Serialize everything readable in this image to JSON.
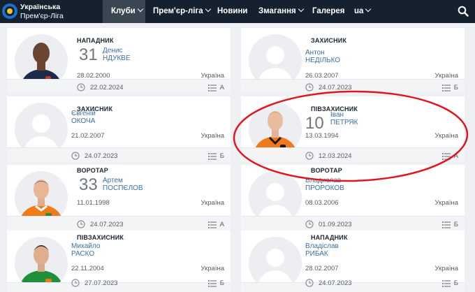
{
  "header": {
    "logo_line1": "Українська",
    "logo_line2": "Прем'єр-Ліга",
    "nav": [
      {
        "label": "Клуби",
        "has_dropdown": true,
        "active": true
      },
      {
        "label": "Прем'єр-ліга",
        "has_dropdown": true,
        "active": false
      },
      {
        "label": "Новини",
        "has_dropdown": false,
        "active": false
      },
      {
        "label": "Змагання",
        "has_dropdown": true,
        "active": false
      },
      {
        "label": "Галерея",
        "has_dropdown": false,
        "active": false
      },
      {
        "label": "ua",
        "has_dropdown": true,
        "active": false
      }
    ],
    "search_icon": "search-icon"
  },
  "players": [
    {
      "position": "НАПАДНИК",
      "number": "31",
      "first_name": "Денис",
      "last_name": "НДУКВЕ",
      "birth_date": "28.02.2000",
      "country": "Україна",
      "joined": "22.02.2024",
      "flag": "А",
      "photo": "player-photo"
    },
    {
      "position": "ЗАХИСНИК",
      "number": "",
      "first_name": "Антон",
      "last_name": "НЕДІЛЬКО",
      "birth_date": "26.03.2007",
      "country": "Україна",
      "joined": "24.07.2023",
      "flag": "Б",
      "photo": "placeholder-avatar"
    },
    {
      "position": "ЗАХИСНИК",
      "number": "",
      "first_name": "Євгеній",
      "last_name": "ОКОЧА",
      "birth_date": "21.02.2007",
      "country": "Україна",
      "joined": "24.07.2023",
      "flag": "Б",
      "photo": "placeholder-avatar"
    },
    {
      "position": "ПІВЗАХИСНИК",
      "number": "10",
      "first_name": "Іван",
      "last_name": "ПЕТРЯК",
      "birth_date": "13.03.1994",
      "country": "Україна",
      "joined": "12.03.2024",
      "flag": "А",
      "photo": "player-photo"
    },
    {
      "position": "ВОРОТАР",
      "number": "33",
      "first_name": "Артем",
      "last_name": "ПОСПЄЛОВ",
      "birth_date": "11.01.1998",
      "country": "Україна",
      "joined": "24.07.2023",
      "flag": "А",
      "photo": "player-photo"
    },
    {
      "position": "ВОРОТАР",
      "number": "",
      "first_name": "Владислав",
      "last_name": "ПРОРОКОВ",
      "birth_date": "08.03.2006",
      "country": "Україна",
      "joined": "01.09.2023",
      "flag": "Б",
      "photo": "placeholder-avatar"
    },
    {
      "position": "ПІВЗАХИСНИК",
      "number": "",
      "first_name": "Михайло",
      "last_name": "РАСКО",
      "birth_date": "22.11.2004",
      "country": "Україна",
      "joined": "27.07.2023",
      "flag": "Б",
      "photo": "player-photo"
    },
    {
      "position": "НАПАДНИК",
      "number": "",
      "first_name": "Владіслав",
      "last_name": "РИБАК",
      "birth_date": "28.02.2007",
      "country": "Україна",
      "joined": "24.07.2023",
      "flag": "Б",
      "photo": "placeholder-avatar"
    }
  ],
  "annotation": {
    "color": "#e0161f",
    "target": "player-card-petriak"
  },
  "colors": {
    "header_bg": "#15212f",
    "link": "#3d6fa5",
    "annotation": "#e0161f",
    "kit_orange": "#f07a1a",
    "kit_navy": "#1d2a4a"
  }
}
